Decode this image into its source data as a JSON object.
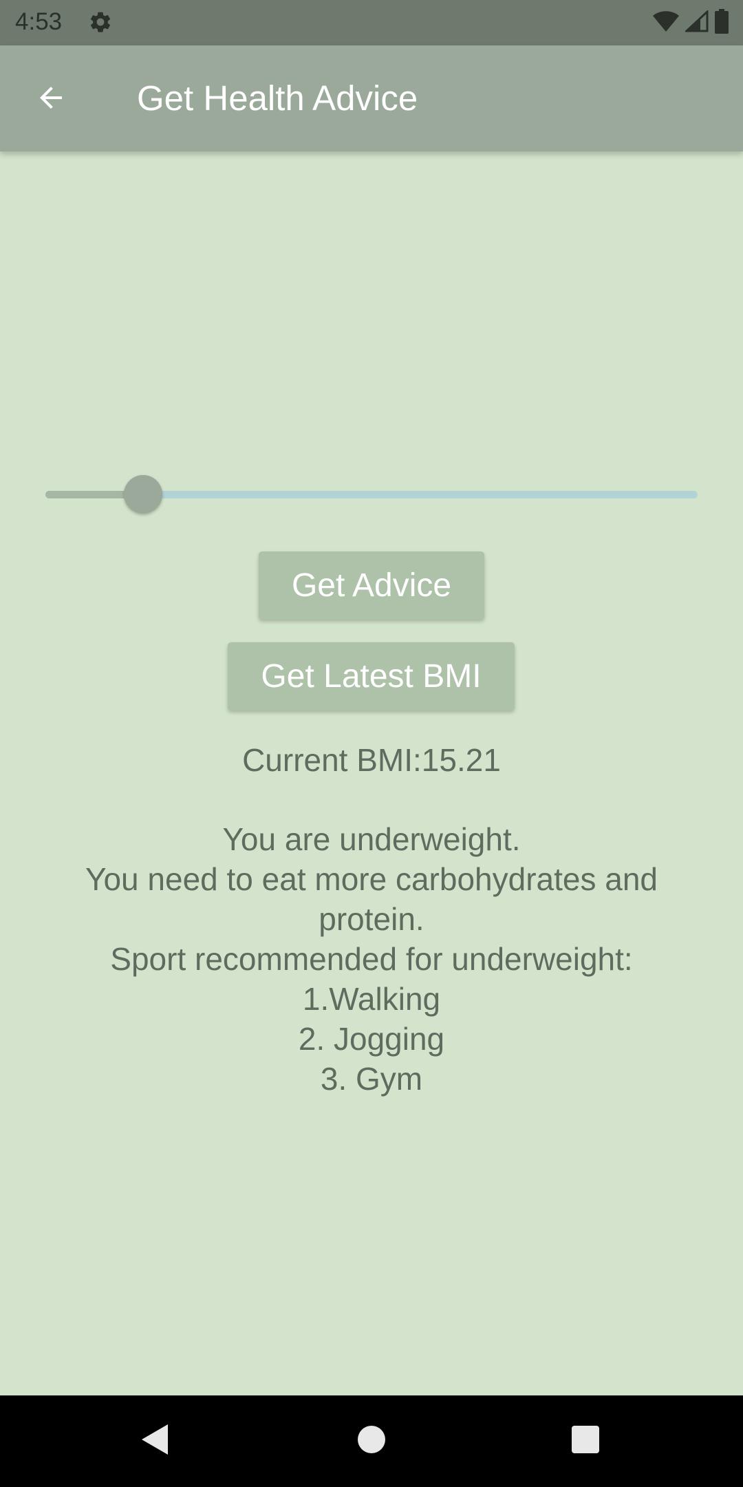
{
  "status_bar": {
    "time": "4:53"
  },
  "app_bar": {
    "title": "Get Health Advice"
  },
  "slider": {
    "value_fraction": 0.15
  },
  "buttons": {
    "get_advice": "Get Advice",
    "get_latest_bmi": "Get Latest BMI"
  },
  "result": {
    "current_bmi": "Current BMI:15.21",
    "lines": [
      "You are underweight.",
      "You need to eat more carbohydrates and",
      "protein.",
      "Sport recommended for underweight:",
      "1.Walking",
      "2. Jogging",
      "3. Gym"
    ]
  },
  "colors": {
    "background": "#d4e4cc",
    "app_bar": "#9aa99a",
    "button": "#aec2aa",
    "text": "#5f6b5e",
    "slider_track": "#b2d3d6"
  },
  "icons": {
    "status_settings": "gear-icon",
    "back": "arrow-left-icon",
    "wifi": "wifi-icon",
    "signal": "signal-icon",
    "battery": "battery-icon",
    "nav_back": "triangle-back-icon",
    "nav_home": "circle-home-icon",
    "nav_recents": "square-recents-icon"
  }
}
